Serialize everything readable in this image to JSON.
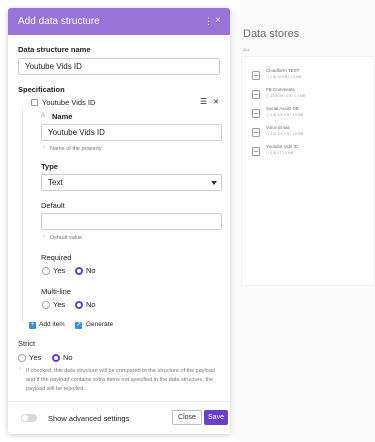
{
  "background": {
    "title": "Data stores",
    "tab": "ALL",
    "items": [
      {
        "name": "Cloudfarm TEST",
        "meta": "▢ 1   ⊞ 19.5 B / 1.0 MB"
      },
      {
        "name": "FB Comments",
        "meta": "▢ 15   ⊞ 397.4 B / 1.0 MB"
      },
      {
        "name": "Social Assist DB",
        "meta": "▢ 1   ⊞ 470.0 B / 1.0 MB"
      },
      {
        "name": "Voice Email",
        "meta": "▢ 1   ⊞ 129.0 B / 1.0 MB"
      },
      {
        "name": "Youtube Vids ID",
        "meta": "▢ 0   ⊞ 0 / 1.0 MB"
      }
    ]
  },
  "dialog": {
    "title": "Add data structure",
    "name_label": "Data structure name",
    "name_value": "Youtube Vids ID",
    "spec_label": "Specification",
    "item": {
      "title": "Youtube Vids ID",
      "drag_icon": "☰",
      "remove_icon": "✕",
      "sort_icon": "A",
      "name_label": "Name",
      "name_value": "Youtube Vids ID",
      "name_hint": "Name of the property.",
      "type_label": "Type",
      "type_value": "Text",
      "default_label": "Default",
      "default_value": "",
      "default_hint": "Default value.",
      "required_label": "Required",
      "required_yes": "Yes",
      "required_no": "No",
      "multiline_label": "Multi-line",
      "multiline_yes": "Yes",
      "multiline_no": "No"
    },
    "add_item": "Add item",
    "generate": "Generate",
    "strict_label": "Strict",
    "strict_yes": "Yes",
    "strict_no": "No",
    "strict_hint": "If checked, this data structure will be compared to the structure of the payload and if the payload contains extra items not specified in the data structure, the payload will be rejected.",
    "advanced_label": "Show advanced settings",
    "close_label": "Close",
    "save_label": "Save"
  },
  "colors": {
    "header": "#9a72d8",
    "accent": "#6a3fc9",
    "hint_icon": "#f2b22a",
    "add_icon": "#3a8fd6"
  },
  "icons": {
    "kebab": "⋮",
    "close": "×",
    "bulb": "♀",
    "plus": "+",
    "generate": "↗"
  }
}
